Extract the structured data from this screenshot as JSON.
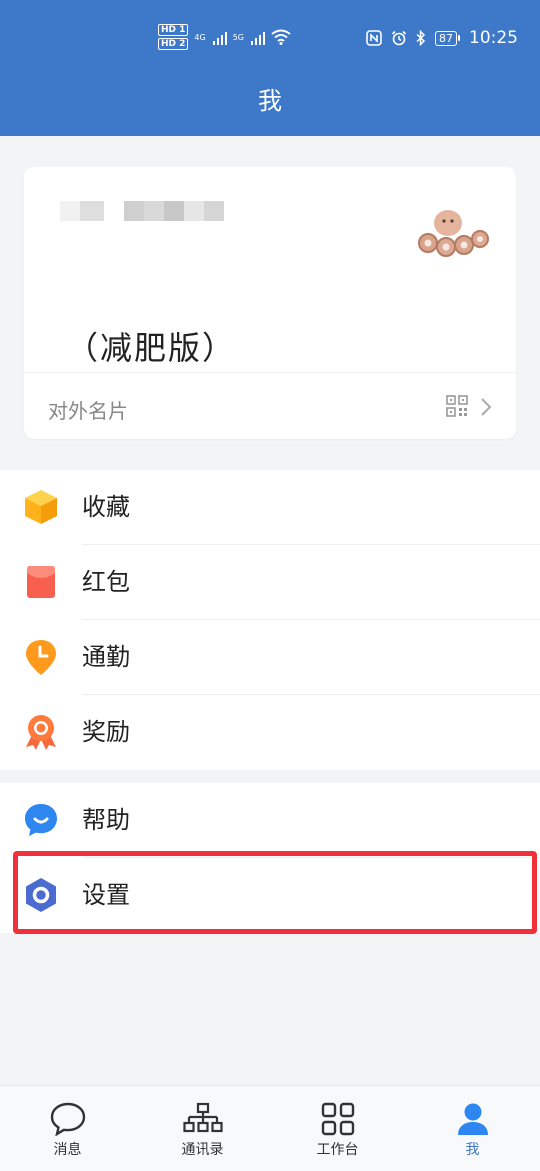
{
  "status_bar": {
    "hd_badges": [
      "HD 1",
      "HD 2"
    ],
    "network_labels": [
      "4G",
      "5G"
    ],
    "battery": "87",
    "time": "10:25"
  },
  "header": {
    "title": "我"
  },
  "profile_card": {
    "name": "（减肥版）",
    "external_card_label": "对外名片"
  },
  "menu_group_1": [
    {
      "label": "收藏",
      "icon": "collection-box-icon"
    },
    {
      "label": "红包",
      "icon": "red-envelope-icon"
    },
    {
      "label": "通勤",
      "icon": "commute-clock-icon"
    },
    {
      "label": "奖励",
      "icon": "award-ribbon-icon"
    }
  ],
  "menu_group_2": [
    {
      "label": "帮助",
      "icon": "help-chat-icon"
    },
    {
      "label": "设置",
      "icon": "settings-hex-icon"
    }
  ],
  "tab_bar": {
    "tabs": [
      {
        "label": "消息",
        "icon": "message-bubble-icon",
        "active": false
      },
      {
        "label": "通讯录",
        "icon": "contacts-tree-icon",
        "active": false
      },
      {
        "label": "工作台",
        "icon": "workbench-grid-icon",
        "active": false
      },
      {
        "label": "我",
        "icon": "person-icon",
        "active": true
      }
    ]
  },
  "colors": {
    "header_bg": "#3d78c9",
    "page_bg": "#f3f4f6",
    "accent": "#3d78c9",
    "highlight_border": "#f0303a"
  }
}
